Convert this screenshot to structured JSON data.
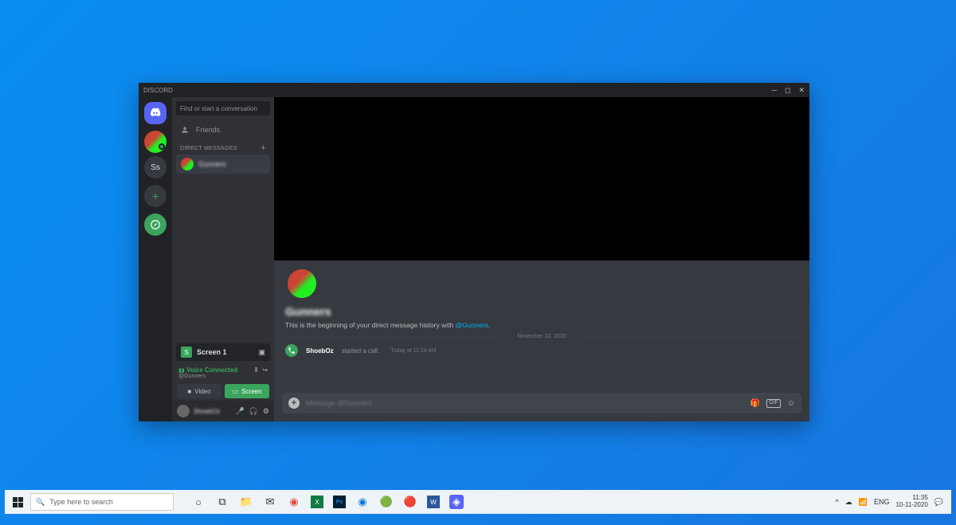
{
  "window": {
    "title": "DISCORD"
  },
  "rail": {
    "server2_label": "Ss"
  },
  "sidebar": {
    "search_placeholder": "Find or start a conversation",
    "friends_label": "Friends",
    "dm_header": "DIRECT MESSAGES",
    "dm_name": "Gunners",
    "screen_label": "Screen 1",
    "voice_status": "Voice Connected",
    "voice_channel": "@Gunners",
    "video_btn": "Video",
    "screen_btn": "Screen",
    "username": "ShoebOz"
  },
  "chat": {
    "bigname": "Gunners",
    "welcome_prefix": "This is the beginning of your direct message history with ",
    "welcome_mention": "@Gunners",
    "divider_date": "November 10, 2020",
    "msg_author": "ShoebOz",
    "msg_action": "started a call.",
    "msg_time": "Today at 11:24 AM",
    "composer_placeholder": "Message @Gunners",
    "gif_label": "GIF"
  },
  "taskbar": {
    "search_placeholder": "Type here to search",
    "lang": "ENG",
    "time": "11:35",
    "date": "10-11-2020"
  }
}
